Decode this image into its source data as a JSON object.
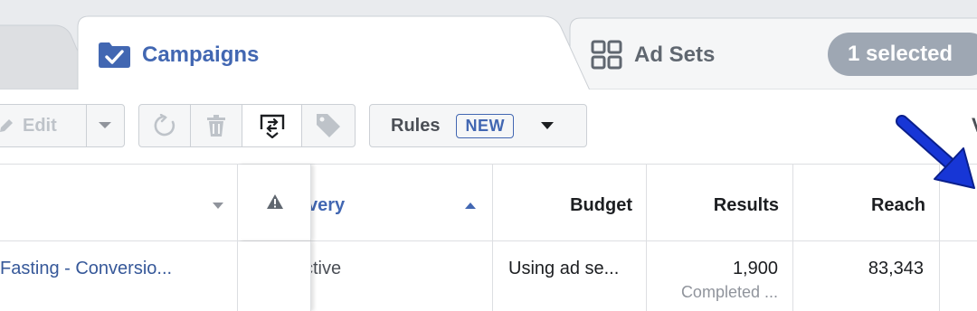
{
  "tabs": {
    "campaigns_label": "Campaigns",
    "adsets_label": "Ad Sets",
    "selected_pill": "1 selected"
  },
  "toolbar": {
    "edit_label": "Edit",
    "rules_label": "Rules",
    "rules_badge": "NEW",
    "cut_off_label": "V",
    "icons": [
      "pencil-icon",
      "chevron-down-icon",
      "refresh-icon",
      "trash-icon",
      "compare-icon",
      "tag-icon",
      "caret-down-icon"
    ]
  },
  "table": {
    "headers": {
      "delivery": "very",
      "budget": "Budget",
      "results": "Results",
      "reach": "Reach"
    },
    "rows": [
      {
        "campaign_name": "Fasting - Conversio...",
        "delivery": "ctive",
        "budget": "Using ad se...",
        "results": "1,900",
        "results_sub": "Completed ...",
        "reach": "83,343"
      }
    ]
  },
  "colors": {
    "brand_blue": "#4267b2",
    "link_blue": "#365899",
    "pill_gray": "#9ea7b3",
    "background": "#e9ebee",
    "annotation_arrow": "#1736d6"
  }
}
